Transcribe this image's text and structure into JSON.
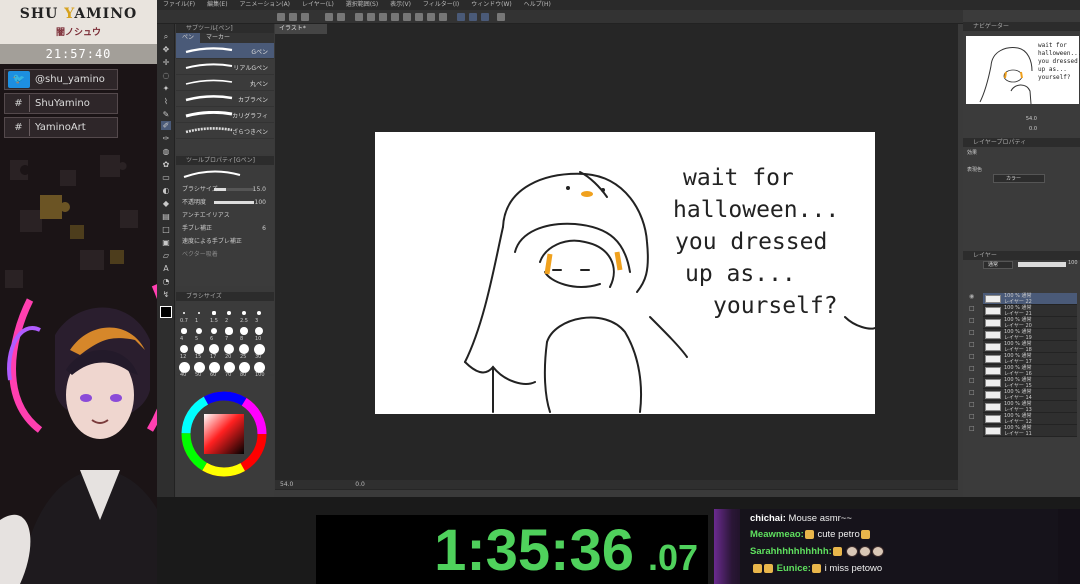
{
  "overlay": {
    "brand_name_part1": "SHU ",
    "brand_name_accent": "Y",
    "brand_name_part2": "AMINO",
    "brand_jp": "闇ノシュウ",
    "clock": "21:57:40",
    "socials": [
      {
        "icon": "twitter-icon",
        "icon_glyph": "🐦",
        "text": "@shu_yamino"
      },
      {
        "icon": "hashtag-icon",
        "icon_glyph": "#",
        "text": "ShuYamino"
      },
      {
        "icon": "hashtag-icon",
        "icon_glyph": "#",
        "text": "YaminoArt"
      }
    ]
  },
  "app": {
    "menu": [
      "ファイル(F)",
      "編集(E)",
      "アニメーション(A)",
      "レイヤー(L)",
      "選択範囲(S)",
      "表示(V)",
      "フィルター(I)",
      "ウィンドウ(W)",
      "ヘルプ(H)"
    ],
    "subtool": {
      "title": "サブツール[ペン]",
      "tabs": [
        "ペン",
        "マーカー"
      ],
      "brushes": [
        "Gペン",
        "リアルGペン",
        "丸ペン",
        "カブラペン",
        "カリグラフィ",
        "ざらつきペン"
      ],
      "selected_index": 0
    },
    "tool_property": {
      "title": "ツールプロパティ[Gペン]",
      "brush_size_label": "ブラシサイズ",
      "brush_size_value": "15.0",
      "opacity_label": "不透明度",
      "opacity_value": "100",
      "antialias_label": "アンチエイリアス",
      "stabilization_label": "手ブレ補正",
      "stabilization_value": "6",
      "speed_label": "速度による手ブレ補正",
      "vector_label": "ベクター吸着"
    },
    "brush_size": {
      "title": "ブラシサイズ",
      "values": [
        "0.7",
        "1",
        "1.5",
        "2",
        "2.5",
        "3",
        "4",
        "5",
        "6",
        "7",
        "8",
        "10",
        "12",
        "15",
        "17",
        "20",
        "25",
        "30",
        "40",
        "50",
        "60",
        "70",
        "80",
        "100"
      ]
    },
    "document_tab": "イラスト*",
    "status_zoom": "54.0",
    "status_rot": "0.0",
    "canvas_text": [
      "wait for",
      "halloween...",
      "you dressed",
      "up as...",
      "yourself?"
    ],
    "navigator_title": "ナビゲーター",
    "navigator_text": [
      "wait for",
      "halloween...",
      "you dressed",
      "up as...",
      "yourself?"
    ],
    "nav_zoom": "54.0",
    "nav_rot": "0.0",
    "layer_property_title": "レイヤープロパティ",
    "effect_label": "効果",
    "color_label": "表現色",
    "color_value": "カラー",
    "layer_title": "レイヤー",
    "blend_mode": "通常",
    "opacity": "100",
    "layers": [
      {
        "pct": "100 % 通常",
        "name": "レイヤー 22"
      },
      {
        "pct": "100 % 通常",
        "name": "レイヤー 21"
      },
      {
        "pct": "100 % 通常",
        "name": "レイヤー 20"
      },
      {
        "pct": "100 % 通常",
        "name": "レイヤー 19"
      },
      {
        "pct": "100 % 通常",
        "name": "レイヤー 18"
      },
      {
        "pct": "100 % 通常",
        "name": "レイヤー 17"
      },
      {
        "pct": "100 % 通常",
        "name": "レイヤー 16"
      },
      {
        "pct": "100 % 通常",
        "name": "レイヤー 15"
      },
      {
        "pct": "100 % 通常",
        "name": "レイヤー 14"
      },
      {
        "pct": "100 % 通常",
        "name": "レイヤー 13"
      },
      {
        "pct": "100 % 通常",
        "name": "レイヤー 12"
      },
      {
        "pct": "100 % 通常",
        "name": "レイヤー 11"
      }
    ]
  },
  "timer": {
    "main": "1:35:36",
    "ms": ".07"
  },
  "chat": [
    {
      "user": "chichai:",
      "user_color": "#ffffff",
      "text": "Mouse asmr~~"
    },
    {
      "user": "Meawmeao:",
      "user_color": "#5fe05f",
      "text": "cute petro"
    },
    {
      "user": "Sarahhhhhhhhhh:",
      "user_color": "#5fe05f",
      "text": ""
    },
    {
      "user": "Eunice:",
      "user_color": "#5fe05f",
      "text": "i miss petowo"
    }
  ],
  "colors": {
    "timer_green": "#4fd15c",
    "selection_blue": "#4a5a78",
    "brand_gold": "#d6a21e"
  }
}
